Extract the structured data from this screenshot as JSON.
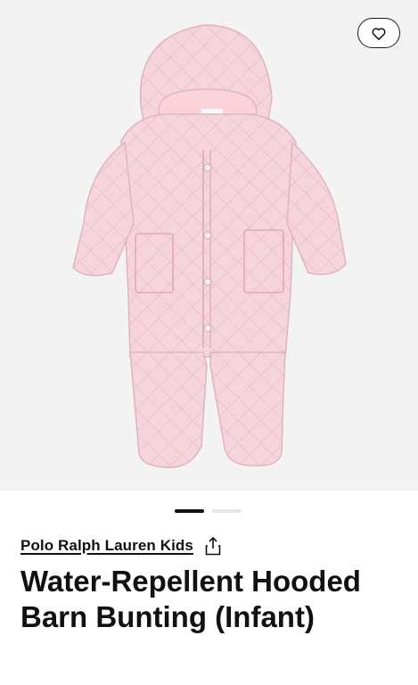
{
  "product": {
    "brand": "Polo Ralph Lauren Kids",
    "title": "Water-Repellent Hooded Barn Bunting (Infant)",
    "label_text": "Ralph Lauren"
  },
  "gallery": {
    "image_count": 2,
    "active_index": 0,
    "garment_color": "#f5d3dc"
  },
  "icons": {
    "favorite": "heart-icon",
    "share": "share-icon"
  }
}
